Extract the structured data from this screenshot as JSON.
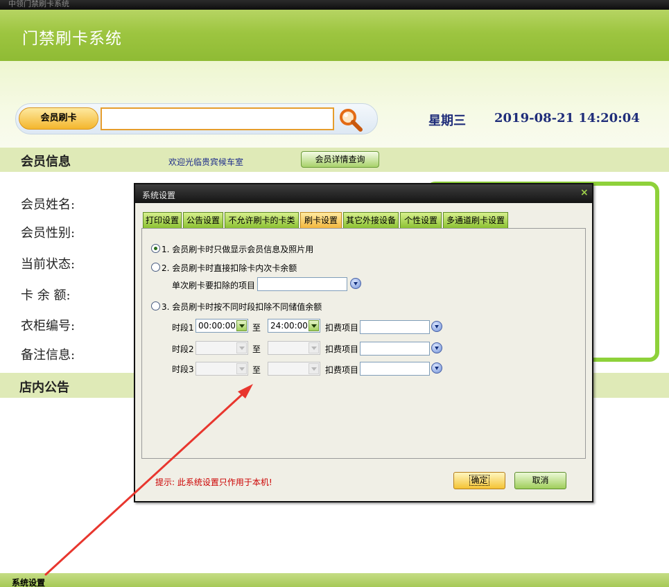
{
  "window": {
    "title": "中领门禁刷卡系统",
    "app_title": "门禁刷卡系统"
  },
  "card_swipe": {
    "label": "会员刷卡",
    "input_value": ""
  },
  "clock": {
    "weekday": "星期三",
    "datetime": "2019-08-21 14:20:04"
  },
  "member_info": {
    "title": "会员信息",
    "welcome": "欢迎光临贵宾候车室",
    "detail_button": "会员详情查询",
    "fields": {
      "name": "会员姓名:",
      "gender": "会员性别:",
      "status": "当前状态:",
      "balance": "卡 余 额:",
      "locker": "衣柜编号:",
      "remark": "备注信息:"
    }
  },
  "notice": {
    "title": "店内公告"
  },
  "status_bar": {
    "text": "系统设置"
  },
  "dialog": {
    "title": "系统设置",
    "close": "×",
    "tabs": [
      "打印设置",
      "公告设置",
      "不允许刷卡的卡类",
      "刷卡设置",
      "其它外接设备",
      "个性设置",
      "多通道刷卡设置"
    ],
    "active_tab": "刷卡设置",
    "options": {
      "opt1": "1. 会员刷卡时只做显示会员信息及照片用",
      "opt2": "2. 会员刷卡时直接扣除卡内次卡余额",
      "opt2_sub_label": "单次刷卡要扣除的项目",
      "opt3": "3. 会员刷卡时按不同时段扣除不同储值余额",
      "selected": 1
    },
    "periods": [
      {
        "label": "时段1",
        "from": "00:00:00",
        "to_label": "至",
        "to": "24:00:00",
        "item_label": "扣费项目",
        "item": ""
      },
      {
        "label": "时段2",
        "from": "",
        "to_label": "至",
        "to": "",
        "item_label": "扣费项目",
        "item": ""
      },
      {
        "label": "时段3",
        "from": "",
        "to_label": "至",
        "to": "",
        "item_label": "扣费项目",
        "item": ""
      }
    ],
    "hint": "提示: 此系统设置只作用于本机!",
    "ok_button": "确定",
    "cancel_button": "取消"
  },
  "colors": {
    "header_green": "#9dc540",
    "accent_orange": "#f4b62d",
    "clock_blue": "#1f2d7a",
    "hint_red": "#cc0000",
    "annotation_red": "#e8362e"
  }
}
